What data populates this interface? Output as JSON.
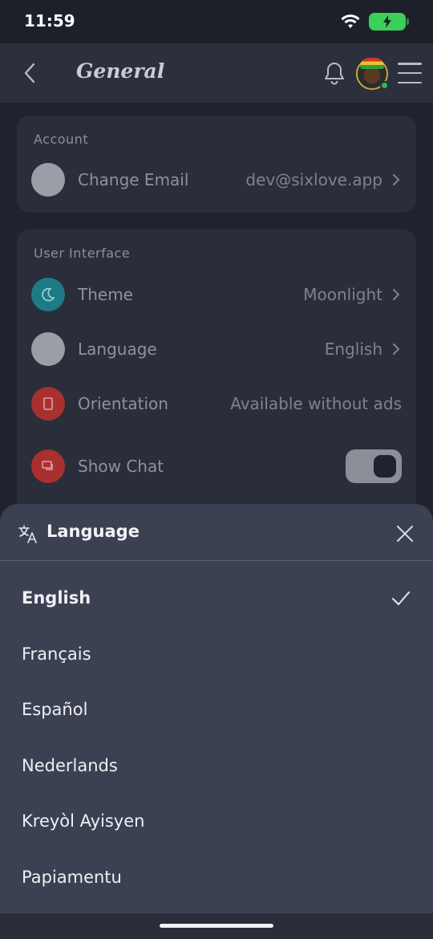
{
  "status": {
    "time": "11:59"
  },
  "header": {
    "title": "General"
  },
  "account": {
    "section_title": "Account",
    "change_email_label": "Change Email",
    "change_email_value": "dev@sixlove.app"
  },
  "ui": {
    "section_title": "User Interface",
    "theme_label": "Theme",
    "theme_value": "Moonlight",
    "language_label": "Language",
    "language_value": "English",
    "orientation_label": "Orientation",
    "orientation_value": "Available without ads",
    "show_chat_label": "Show Chat"
  },
  "sheet": {
    "title": "Language",
    "options": [
      "English",
      "Français",
      "Español",
      "Nederlands",
      "Kreyòl Ayisyen",
      "Papiamentu"
    ],
    "selected": "English"
  },
  "colors": {
    "accent_teal": "#1d7b87",
    "accent_red": "#a8302f",
    "sheet_bg": "#3b4152",
    "battery_green": "#3ad05a"
  },
  "icons": {
    "back": "chevron-left-icon",
    "bell": "bell-icon",
    "menu": "hamburger-icon",
    "theme": "moon-icon",
    "orientation": "rotate-icon",
    "chat": "chat-icon",
    "translate": "translate-icon",
    "close": "close-icon",
    "selected": "checkmark-icon"
  }
}
